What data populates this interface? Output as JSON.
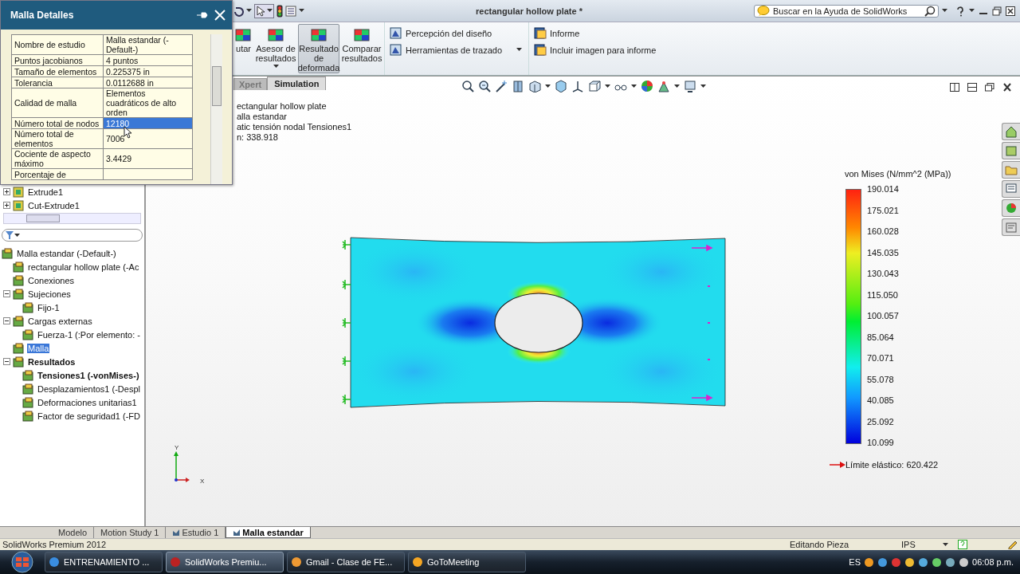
{
  "window": {
    "title": "rectangular hollow plate *"
  },
  "help_search": {
    "placeholder": "Buscar en la Ayuda de SolidWorks"
  },
  "ribbon": {
    "large_buttons": [
      {
        "label": "utar",
        "selected": false
      },
      {
        "label": "Asesor de resultados",
        "selected": false
      },
      {
        "label": "Resultado de deformada",
        "selected": true
      },
      {
        "label": "Comparar resultados",
        "selected": false
      }
    ],
    "small_buttons": [
      {
        "label": "Percepción del diseño",
        "kind": "plain"
      },
      {
        "label": "Herramientas de trazado",
        "kind": "dropdown"
      },
      {
        "label": "Informe",
        "kind": "plain"
      },
      {
        "label": "Incluir imagen para informe",
        "kind": "plain"
      }
    ]
  },
  "command_tabs": [
    {
      "label": "Xpert",
      "selected": false
    },
    {
      "label": "Simulation",
      "selected": true
    }
  ],
  "details_panel": {
    "title": "Malla Detalles",
    "rows": [
      {
        "name": "Nombre de estudio",
        "value": "Malla estandar (-Default-)",
        "selected": false
      },
      {
        "name": "Puntos jacobianos",
        "value": "4 puntos",
        "selected": false
      },
      {
        "name": "Tamaño de elementos",
        "value": "0.225375 in",
        "selected": false
      },
      {
        "name": "Tolerancia",
        "value": "0.0112688 in",
        "selected": false
      },
      {
        "name": "Calidad de malla",
        "value": "Elementos cuadráticos de alto orden",
        "selected": false
      },
      {
        "name": "Número total de nodos",
        "value": "12180",
        "selected": true
      },
      {
        "name": "Número total de elementos",
        "value": "7006",
        "selected": false
      },
      {
        "name": "Cociente de aspecto máximo",
        "value": "3.4429",
        "selected": false
      },
      {
        "name": "Porcentaje de",
        "value": "",
        "selected": false
      }
    ]
  },
  "feature_tree": {
    "items": [
      {
        "label": "Extrude1",
        "expanded": false
      },
      {
        "label": "Cut-Extrude1",
        "expanded": false
      }
    ]
  },
  "study_tree": {
    "items": [
      {
        "label": "Malla estandar (-Default-)",
        "selected": false,
        "active": false,
        "children": [
          {
            "label": "rectangular hollow plate (-Ac",
            "selected": false,
            "active": false
          },
          {
            "label": "Conexiones",
            "selected": false,
            "active": false
          },
          {
            "label": "Sujeciones",
            "selected": false,
            "active": false,
            "expanded": true,
            "children": [
              {
                "label": "Fijo-1",
                "selected": false,
                "active": false
              }
            ]
          },
          {
            "label": "Cargas externas",
            "selected": false,
            "active": false,
            "expanded": true,
            "children": [
              {
                "label": "Fuerza-1 (:Por elemento: -",
                "selected": false,
                "active": false
              }
            ]
          },
          {
            "label": "Malla",
            "selected": true,
            "active": false
          },
          {
            "label": "Resultados",
            "selected": false,
            "active": true,
            "expanded": true,
            "children": [
              {
                "label": "Tensiones1 (-vonMises-)",
                "selected": false,
                "active": true
              },
              {
                "label": "Desplazamientos1 (-Despl",
                "selected": false,
                "active": false
              },
              {
                "label": "Deformaciones unitarias1",
                "selected": false,
                "active": false
              },
              {
                "label": "Factor de seguridad1 (-FD",
                "selected": false,
                "active": false
              }
            ]
          }
        ]
      }
    ]
  },
  "viewport": {
    "info_lines": [
      "ectangular hollow plate",
      "alla estandar",
      "atic tensión nodal Tensiones1",
      "n: 338.918"
    ],
    "triad": {
      "x": "X",
      "y": "Y"
    }
  },
  "legend": {
    "title": "von Mises (N/mm^2 (MPa))",
    "ticks": [
      "190.014",
      "175.021",
      "160.028",
      "145.035",
      "130.043",
      "115.050",
      "100.057",
      "85.064",
      "70.071",
      "55.078",
      "40.085",
      "25.092",
      "10.099"
    ],
    "yield": "Límite elástico: 620.422"
  },
  "bottom_tabs": [
    {
      "label": "Modelo",
      "selected": false
    },
    {
      "label": "Motion Study 1",
      "selected": false
    },
    {
      "label": "Estudio 1",
      "selected": false
    },
    {
      "label": "Malla estandar",
      "selected": true
    }
  ],
  "status_bar": {
    "app": "SolidWorks Premium 2012",
    "mode": "Editando Pieza",
    "units": "IPS"
  },
  "taskbar": {
    "items": [
      {
        "label": "ENTRENAMIENTO ...",
        "selected": false
      },
      {
        "label": "SolidWorks Premiu...",
        "selected": true
      },
      {
        "label": "Gmail - Clase de FE...",
        "selected": false
      },
      {
        "label": "GoToMeeting",
        "selected": false
      }
    ],
    "language": "ES",
    "clock": "06:08 p.m."
  }
}
